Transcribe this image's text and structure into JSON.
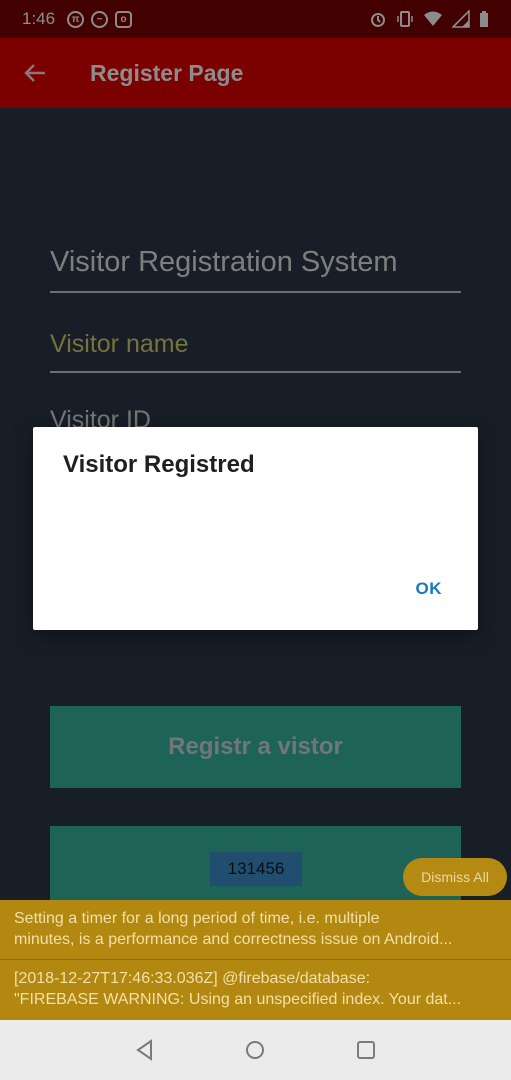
{
  "status_bar": {
    "time": "1:46",
    "icons": [
      "pi-icon",
      "messenger-icon",
      "instagram-icon",
      "alarm-icon",
      "vibrate-icon",
      "wifi-icon",
      "signal-icon",
      "battery-icon"
    ]
  },
  "app_bar": {
    "title": "Register Page"
  },
  "form": {
    "title_placeholder": "Visitor Registration System",
    "name_placeholder": "Visitor name",
    "id_partial": "Visitor ID",
    "register_button": "Registr a vistor",
    "id_value": "131456"
  },
  "dialog": {
    "title": "Visitor Registred",
    "ok_label": "OK"
  },
  "warnings": {
    "dismiss_all": "Dismiss All",
    "items": [
      {
        "line1": "Setting a timer for a long period of time, i.e. multiple",
        "line2": "minutes, is a performance and correctness issue on Android..."
      },
      {
        "line1": "[2018-12-27T17:46:33.036Z]  @firebase/database:",
        "line2": "\"FIREBASE WARNING: Using an unspecified index. Your dat..."
      }
    ]
  },
  "colors": {
    "app_bar": "#e00000",
    "status_bar": "#7a0000",
    "background": "#2b3848",
    "button": "#37b49e",
    "accent_ok": "#147bc4",
    "warning": "#b38810"
  }
}
